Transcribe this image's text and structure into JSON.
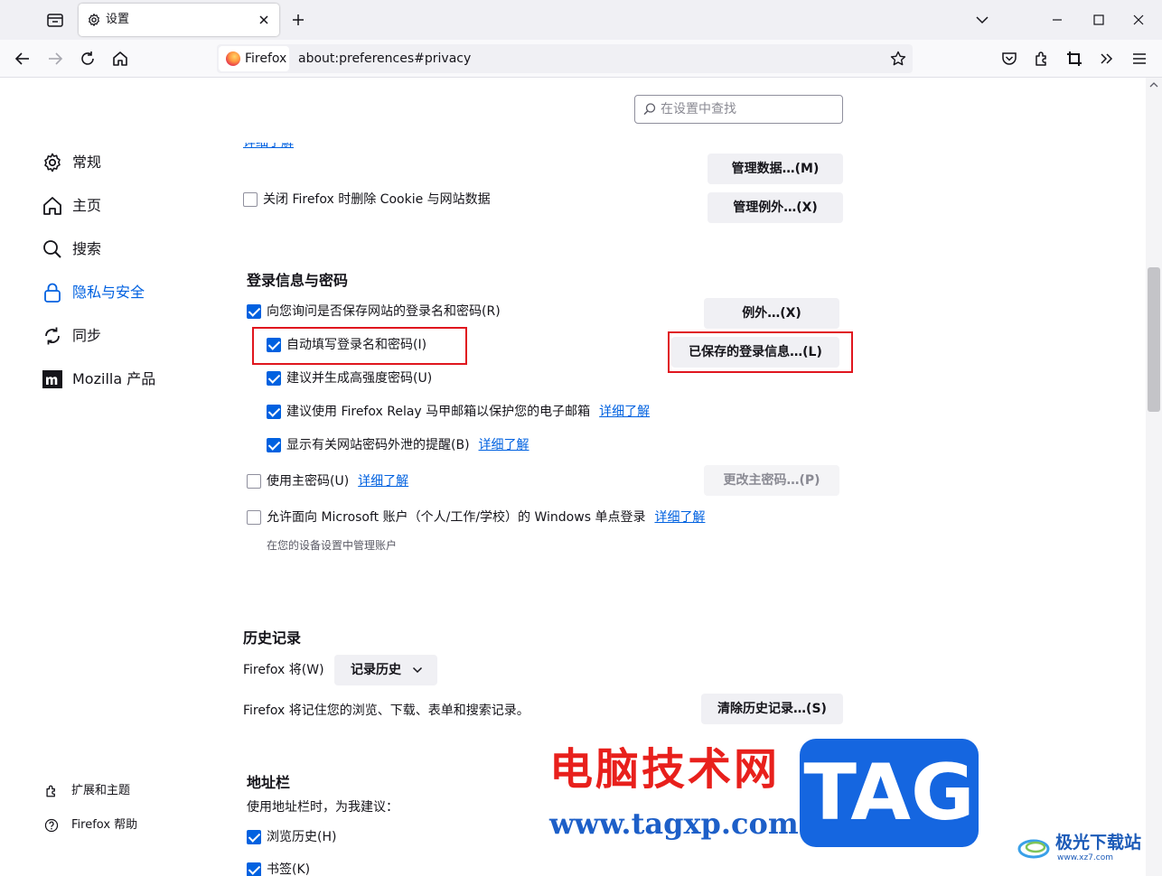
{
  "tab": {
    "title": "设置"
  },
  "urlbar": {
    "identity": "Firefox",
    "url": "about:preferences#privacy"
  },
  "search": {
    "placeholder": "在设置中查找"
  },
  "sidebar": {
    "items": [
      {
        "label": "常规"
      },
      {
        "label": "主页"
      },
      {
        "label": "搜索"
      },
      {
        "label": "隐私与安全"
      },
      {
        "label": "同步"
      },
      {
        "label": "Mozilla 产品"
      }
    ],
    "footer": [
      {
        "label": "扩展和主题"
      },
      {
        "label": "Firefox 帮助"
      }
    ]
  },
  "cookies": {
    "learn_more_cut": "详细了解",
    "manage_data_button": "管理数据…(M)",
    "manage_exceptions_button": "管理例外…(X)",
    "delete_on_close_label": "关闭 Firefox 时删除 Cookie 与网站数据",
    "delete_on_close_checked": false
  },
  "logins": {
    "heading": "登录信息与密码",
    "ask_save_label": "向您询问是否保存网站的登录名和密码(R)",
    "autofill_label": "自动填写登录名和密码(I)",
    "suggest_strong_label": "建议并生成高强度密码(U)",
    "relay_label": "建议使用 Firefox Relay 马甲邮箱以保护您的电子邮箱",
    "relay_link": "详细了解",
    "breach_label": "显示有关网站密码外泄的提醒(B)",
    "breach_link": "详细了解",
    "primary_pw_label": "使用主密码(U)",
    "primary_pw_link": "详细了解",
    "windows_sso_label": "允许面向 Microsoft 账户（个人/工作/学校）的 Windows 单点登录",
    "windows_sso_link": "详细了解",
    "windows_sso_note": "在您的设备设置中管理账户",
    "exceptions_button": "例外…(X)",
    "saved_logins_button": "已保存的登录信息…(L)",
    "change_primary_button": "更改主密码…(P)"
  },
  "history": {
    "heading": "历史记录",
    "will_label": "Firefox 将(W)",
    "mode_value": "记录历史",
    "description": "Firefox 将记住您的浏览、下载、表单和搜索记录。",
    "clear_button": "清除历史记录…(S)"
  },
  "addressbar": {
    "heading": "地址栏",
    "suggest_label": "使用地址栏时，为我建议：",
    "browsing_history_label": "浏览历史(H)",
    "bookmarks_label": "书签(K)"
  },
  "watermark": {
    "cn_text": "电脑技术网",
    "url_text": "www.tagxp.com",
    "tag_text": "TAG",
    "site_text": "极光下载站",
    "site_sub": "www.xz7.com"
  },
  "colors": {
    "accent": "#0061e0",
    "highlight": "#e0161e",
    "watermark_red": "#e8201c",
    "watermark_blue": "#1566e0"
  }
}
